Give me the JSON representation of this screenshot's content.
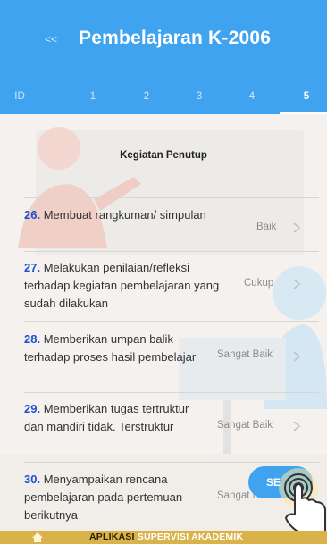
{
  "header": {
    "back_label": "<<",
    "title": "Pembelajaran K-2006"
  },
  "tabs": [
    {
      "label": "ID",
      "active": false
    },
    {
      "label": "1",
      "active": false
    },
    {
      "label": "2",
      "active": false
    },
    {
      "label": "3",
      "active": false
    },
    {
      "label": "4",
      "active": false
    },
    {
      "label": "5",
      "active": true
    }
  ],
  "section": {
    "title": "Kegiatan Penutup"
  },
  "items": [
    {
      "number": "26.",
      "text": "Membuat rangkuman/ simpulan",
      "value": "Baik"
    },
    {
      "number": "27.",
      "text": "Melakukan penilaian/refleksi terhadap kegiatan pembelajaran yang sudah dilakukan",
      "value": "Cukup"
    },
    {
      "number": "28.",
      "text": "Memberikan umpan balik terhadap proses hasil pembelajar",
      "value": "Sangat Baik"
    },
    {
      "number": "29.",
      "text": "Memberikan tugas tertruktur dan mandiri tidak. Terstruktur",
      "value": "Sangat Baik"
    },
    {
      "number": "30.",
      "text": "Menyampaikan rencana pembelajaran pada pertemuan berikutnya",
      "value": "Sangat Baik"
    }
  ],
  "fab": {
    "label": "SE"
  },
  "footer": {
    "label_part1": "APLIKASI",
    "label_part2": "SUPERVISI AKADEMIK"
  },
  "colors": {
    "header_bg": "#3fa3f0",
    "number_accent": "#1d4fd0",
    "footer_bg": "#d9b24a"
  },
  "icons": [
    "chevron-right-icon",
    "home-icon",
    "touch-hand-icon"
  ]
}
